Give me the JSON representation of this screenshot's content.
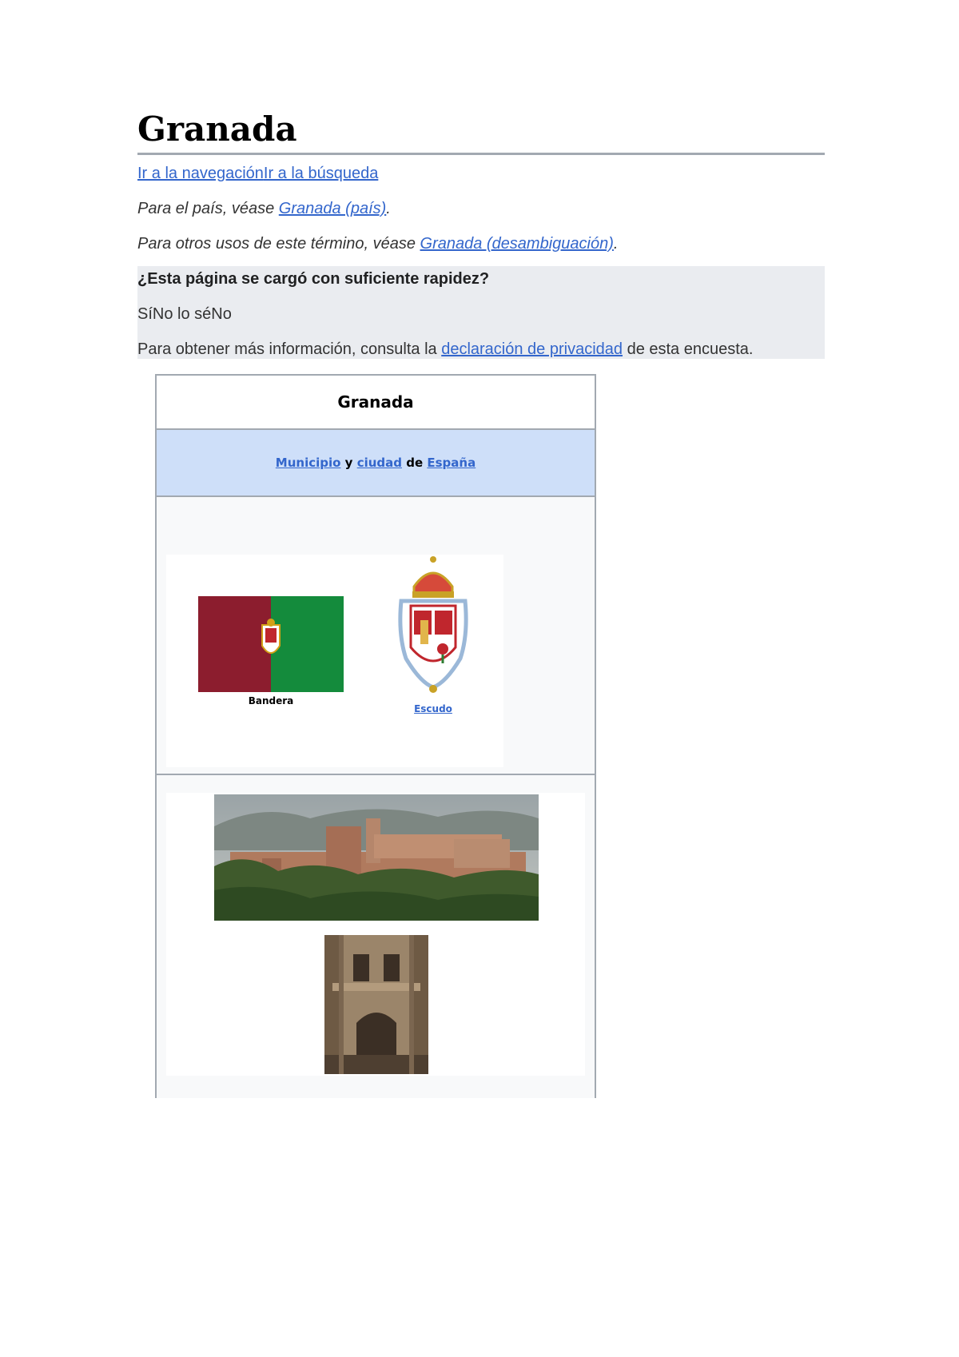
{
  "page": {
    "title": "Granada",
    "skip_nav": "Ir a la navegación",
    "skip_search": "Ir a la búsqueda",
    "hatnote_country_prefix": "Para el país, véase ",
    "hatnote_country_link": "Granada (país)",
    "hatnote_country_suffix": ".",
    "hatnote_other_prefix": "Para otros usos de este término, véase ",
    "hatnote_other_link": "Granada (desambiguación)",
    "hatnote_other_suffix": "."
  },
  "survey": {
    "question": "¿Esta página se cargó con suficiente rapidez?",
    "options": [
      "Sí",
      "No lo sé",
      "No"
    ],
    "info_prefix": "Para obtener más información, consulta la ",
    "info_link": "declaración de privacidad",
    "info_suffix": " de esta encuesta."
  },
  "infobox": {
    "title": "Granada",
    "subtitle_link1": "Municipio",
    "subtitle_sep1": " y ",
    "subtitle_link2": "ciudad",
    "subtitle_sep2": " de ",
    "subtitle_link3": "España",
    "flag_caption": "Bandera",
    "coa_caption": "Escudo"
  },
  "colors": {
    "link": "#3366cc",
    "flag_left": "#8c1d2e",
    "flag_right": "#148b3c",
    "infobox_header": "#cedff9"
  }
}
